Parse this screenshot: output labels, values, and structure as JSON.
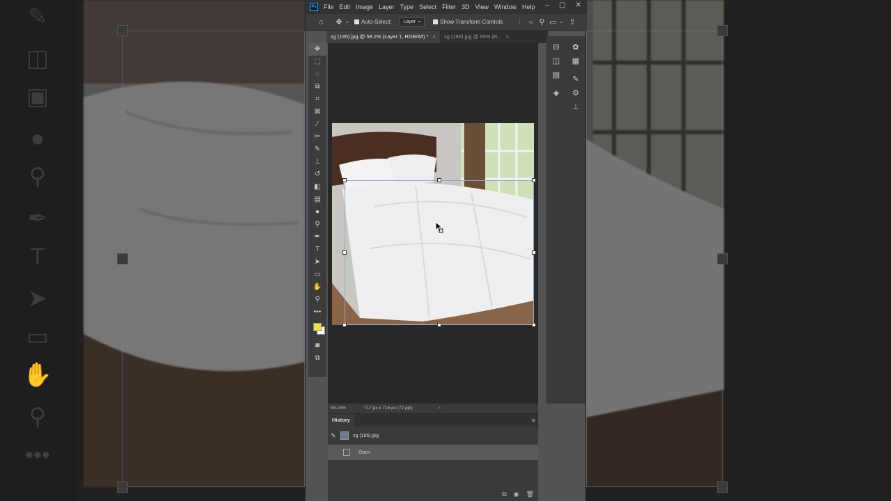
{
  "menubar": {
    "app_logo": "Ps",
    "items": [
      "File",
      "Edit",
      "Image",
      "Layer",
      "Type",
      "Select",
      "Filter",
      "3D",
      "View",
      "Window",
      "Help"
    ],
    "window_controls": [
      "–",
      "▢",
      "✕"
    ]
  },
  "options": {
    "auto_select_label": "Auto-Select:",
    "auto_select_checked": true,
    "target_value": "Layer",
    "show_transform_label": "Show Transform Controls",
    "show_transform_checked": true
  },
  "tabs": [
    {
      "label": "sg (185).jpg @ 58.2% (Layer 1, RGB/8#) *",
      "close": "×",
      "active": true
    },
    {
      "label": "sg (186).jpg @ 50% (R...",
      "close": "×",
      "active": false
    }
  ],
  "tools": [
    "move-tool",
    "marquee-tool",
    "lasso-tool",
    "object-select-tool",
    "crop-tool",
    "frame-tool",
    "eyedropper-tool",
    "healing-tool",
    "brush-tool",
    "stamp-tool",
    "history-brush-tool",
    "eraser-tool",
    "gradient-tool",
    "blur-tool",
    "dodge-tool",
    "pen-tool",
    "type-tool",
    "path-select-tool",
    "rectangle-tool",
    "hand-tool",
    "zoom-tool",
    "more-tools"
  ],
  "colors": {
    "foreground": "#f5e046",
    "background": "#ffffff",
    "app_bg": "#535353",
    "canvas_bg": "#282828"
  },
  "status": {
    "zoom": "58.16%",
    "doc_size": "717 px x 716 px (72 ppi)",
    "arrow": "›"
  },
  "history": {
    "title": "History",
    "menu": "≡",
    "snapshot_label": "sg (186).jpg",
    "steps": [
      {
        "label": "Open",
        "selected": true
      }
    ],
    "footer": [
      "new-document-from-state-icon",
      "camera-icon",
      "trash-icon"
    ]
  }
}
